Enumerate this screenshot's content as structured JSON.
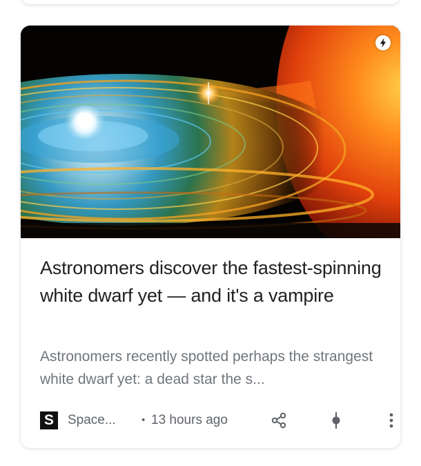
{
  "article": {
    "title": "Astronomers discover the fastest-spinning white dwarf yet — and it's a vampire",
    "snippet": "Astronomers recently spotted perhaps the strangest white dwarf yet: a dead star the s...",
    "source_logo_letter": "S",
    "source_name": "Space...",
    "separator": "•",
    "time_ago": "13 hours ago",
    "hero_image": "white dwarf accretion disk with red star",
    "badges": [
      "amp-lightning-icon"
    ]
  },
  "actions": [
    {
      "name": "share",
      "icon": "share-icon"
    },
    {
      "name": "control-interest",
      "icon": "control-interest-icon"
    },
    {
      "name": "more",
      "icon": "more-vert-icon"
    }
  ],
  "colors": {
    "title": "#202124",
    "secondary_text": "#70757a",
    "icon": "#5f6368",
    "card_background": "#ffffff"
  }
}
